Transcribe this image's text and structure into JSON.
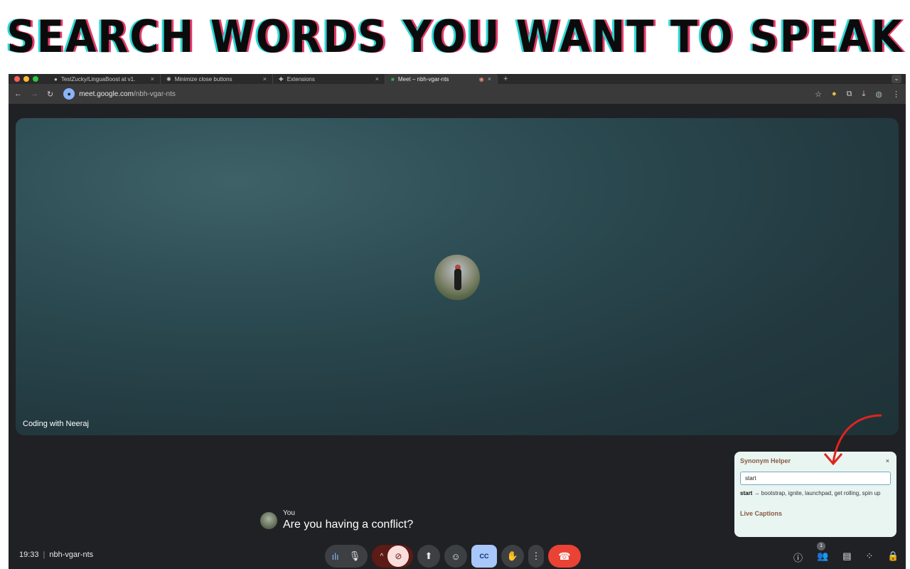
{
  "banner": {
    "title": "SEARCH WORDS YOU WANT TO SPEAK"
  },
  "browser": {
    "tabs": [
      {
        "label": "TestZucky/LinguaBoost at v1.",
        "icon": "github-icon"
      },
      {
        "label": "Minimize close buttons",
        "icon": "chatgpt-icon"
      },
      {
        "label": "Extensions",
        "icon": "puzzle-icon"
      },
      {
        "label": "Meet – nbh-vgar-nts",
        "icon": "meet-icon",
        "active": true
      }
    ],
    "url_host": "meet.google.com",
    "url_path": "/nbh-vgar-nts"
  },
  "meet": {
    "participant_name": "Coding with Neeraj",
    "caption": {
      "speaker": "You",
      "text": "Are you having a conflict?"
    },
    "time": "19:33",
    "meeting_code": "nbh-vgar-nts",
    "people_count": "1",
    "colors": {
      "end_call": "#ea4335",
      "captions_on": "#a8c7fa",
      "camera_off": "#f9dedc"
    }
  },
  "helper": {
    "title": "Synonym Helper",
    "close": "×",
    "input_value": "start",
    "result_word": "start",
    "result_synonyms": "→ bootstrap, ignite, launchpad, get rolling, spin up",
    "live_label": "Live Captions"
  }
}
